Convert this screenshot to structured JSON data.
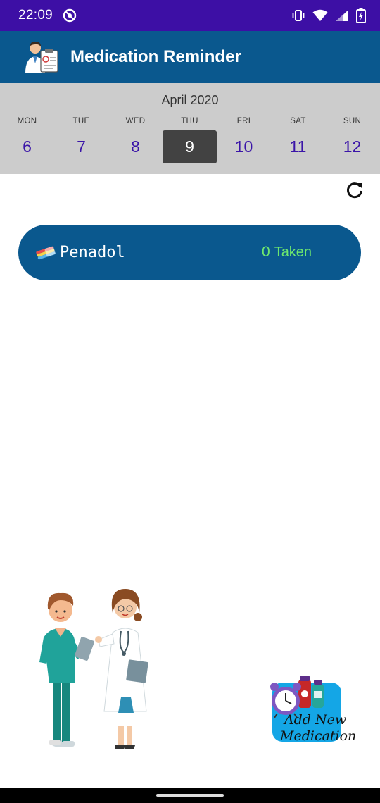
{
  "status_bar": {
    "time": "22:09",
    "icons": [
      "app-notification-icon",
      "vibrate-icon",
      "wifi-icon",
      "signal-icon",
      "battery-charging-icon"
    ]
  },
  "app_bar": {
    "title": "Medication Reminder",
    "logo": "doctor-clipboard-icon"
  },
  "calendar": {
    "month": "April 2020",
    "days": [
      {
        "name": "MON",
        "number": "6",
        "selected": false
      },
      {
        "name": "TUE",
        "number": "7",
        "selected": false
      },
      {
        "name": "WED",
        "number": "8",
        "selected": false
      },
      {
        "name": "THU",
        "number": "9",
        "selected": true
      },
      {
        "name": "FRI",
        "number": "10",
        "selected": false
      },
      {
        "name": "SAT",
        "number": "11",
        "selected": false
      },
      {
        "name": "SUN",
        "number": "12",
        "selected": false
      }
    ]
  },
  "refresh": {
    "icon": "refresh-icon"
  },
  "medications": [
    {
      "name": "Penadol",
      "taken_count": "0",
      "taken_label": "Taken",
      "icon": "pills-icon"
    }
  ],
  "add_button": {
    "line1": "Add New",
    "line2": "Medication",
    "icon": "alarm-clock-bottles-icon"
  },
  "colors": {
    "status_bar": "#3d0fa5",
    "app_bar": "#0a588e",
    "calendar_bg": "#cccccc",
    "day_number": "#3a14a8",
    "selected_day_bg": "#424242",
    "taken_text": "#6ee86e",
    "add_button_bg": "#14a6e6"
  }
}
